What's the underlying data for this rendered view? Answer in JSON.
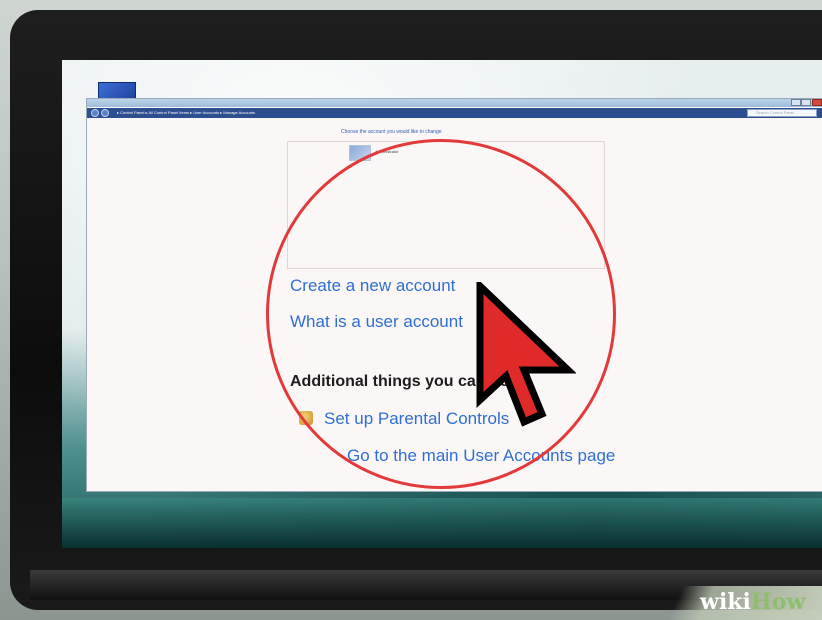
{
  "explorer": {
    "breadcrumb": "▸ Control Panel ▸ All Control Panel Items ▸ User Accounts ▸ Manage Accounts",
    "search_placeholder": "Search Control Panel"
  },
  "main": {
    "choose_prompt": "Choose the account you would like to change",
    "account_name": "Administrator",
    "tasks": {
      "create_account": "Create a new account",
      "what_is_account": "What is a user account"
    },
    "additional_heading": "Additional things you can do",
    "additional_links": {
      "parental_controls": "Set up Parental Controls",
      "main_user_accounts": "Go to the main User Accounts page"
    }
  },
  "watermark": {
    "part1": "wiki",
    "part2": "How"
  },
  "colors": {
    "highlight_circle": "#e23a3a",
    "link_blue": "#2f6fd3",
    "cursor_red": "#e02a2a"
  }
}
